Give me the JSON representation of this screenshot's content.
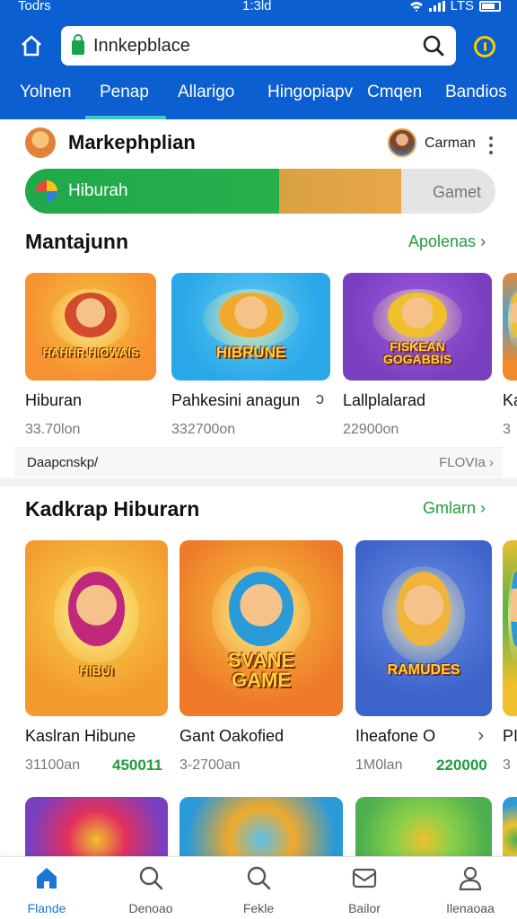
{
  "status_bar": {
    "left": "Todrs",
    "time": "1:3ld",
    "right": "LTS"
  },
  "browser": {
    "url": "Innkepblace"
  },
  "tabs": [
    {
      "label": "Yolnen"
    },
    {
      "label": "Penap"
    },
    {
      "label": "Allarigo"
    },
    {
      "label": "Hingopiapv"
    },
    {
      "label": "Cmqen"
    },
    {
      "label": "Bandios"
    }
  ],
  "marketplace": {
    "title": "Markephplian",
    "user_name": "Carman"
  },
  "progress": {
    "label": "Hiburah",
    "right_label": "Gamet",
    "green_fraction": 0.54,
    "orange_fraction": 0.26
  },
  "section1": {
    "title": "Mantajunn",
    "link": "Apolenas",
    "cards": [
      {
        "name": "Hiburan",
        "price": "33.70lon",
        "badge": "HAHHR HIOWAIS",
        "colors": [
          "#f79232",
          "#f2c53d",
          "#d44a2c"
        ]
      },
      {
        "name": "Pahkesini anagun",
        "price": "332700on",
        "badge": "HIBRUNE",
        "colors": [
          "#29a7e8",
          "#60cbf3",
          "#f0a92b"
        ]
      },
      {
        "name": "Lallplalarad",
        "price": "22900on",
        "badge": "FISKEAN GOGABBIS",
        "colors": [
          "#7a3fc0",
          "#a05be0",
          "#f0c02c"
        ]
      },
      {
        "name": "Ka",
        "price": "3",
        "badge": "",
        "colors": [
          "#f08a2b",
          "#3aa3e6",
          "#f0c02c"
        ]
      }
    ],
    "extra_icon": "ɔ",
    "footer_left": "Daapcnskp/",
    "footer_right": "FLOVIa"
  },
  "section2": {
    "title": "Kadkrap Hiburarn",
    "link": "Gmlarn",
    "cards": [
      {
        "name": "Kaslran Hibune",
        "price": "31100an",
        "green_price": "450011",
        "badge": "HIBUI",
        "colors": [
          "#f39b2f",
          "#f7d54a",
          "#c0287c"
        ]
      },
      {
        "name": "Gant Oakofied",
        "price": "3-2700an",
        "green_price": "",
        "badge": "SVANE GAME",
        "colors": [
          "#ee7a2a",
          "#f6c43b",
          "#2b9ad9"
        ]
      },
      {
        "name": "Iheafone O",
        "price": "1M0lan",
        "green_price": "220000",
        "badge": "RAMUDES",
        "colors": [
          "#3b63c9",
          "#6d8ee6",
          "#f0b43a"
        ]
      },
      {
        "name": "PI",
        "price": "3",
        "green_price": "",
        "badge": "",
        "colors": [
          "#f0c02c",
          "#4caf50",
          "#2b9ad9"
        ]
      }
    ],
    "third_card_chevron": "›"
  },
  "section3_cards": [
    {
      "colors": [
        "#7a3fc0",
        "#e2305e",
        "#f0c02c"
      ]
    },
    {
      "colors": [
        "#2b9ad9",
        "#f0a92b",
        "#56c2f0"
      ]
    },
    {
      "colors": [
        "#4caf50",
        "#8ad04a",
        "#f0c02c"
      ]
    },
    {
      "colors": [
        "#2b9ad9",
        "#f0c02c",
        "#4caf50"
      ]
    }
  ],
  "bottom_nav": [
    {
      "label": "Flande",
      "icon": "home-icon",
      "active": true
    },
    {
      "label": "Denoao",
      "icon": "search-icon",
      "active": false
    },
    {
      "label": "Fekle",
      "icon": "search-icon",
      "active": false
    },
    {
      "label": "Bailor",
      "icon": "inbox-icon",
      "active": false
    },
    {
      "label": "Ilenaoaa",
      "icon": "person-icon",
      "active": false
    }
  ],
  "colors": {
    "header_blue": "#0b5fd1",
    "accent_green": "#1f9c3e",
    "tab_underline": "#3ec7c3",
    "active_nav": "#1976d2"
  }
}
